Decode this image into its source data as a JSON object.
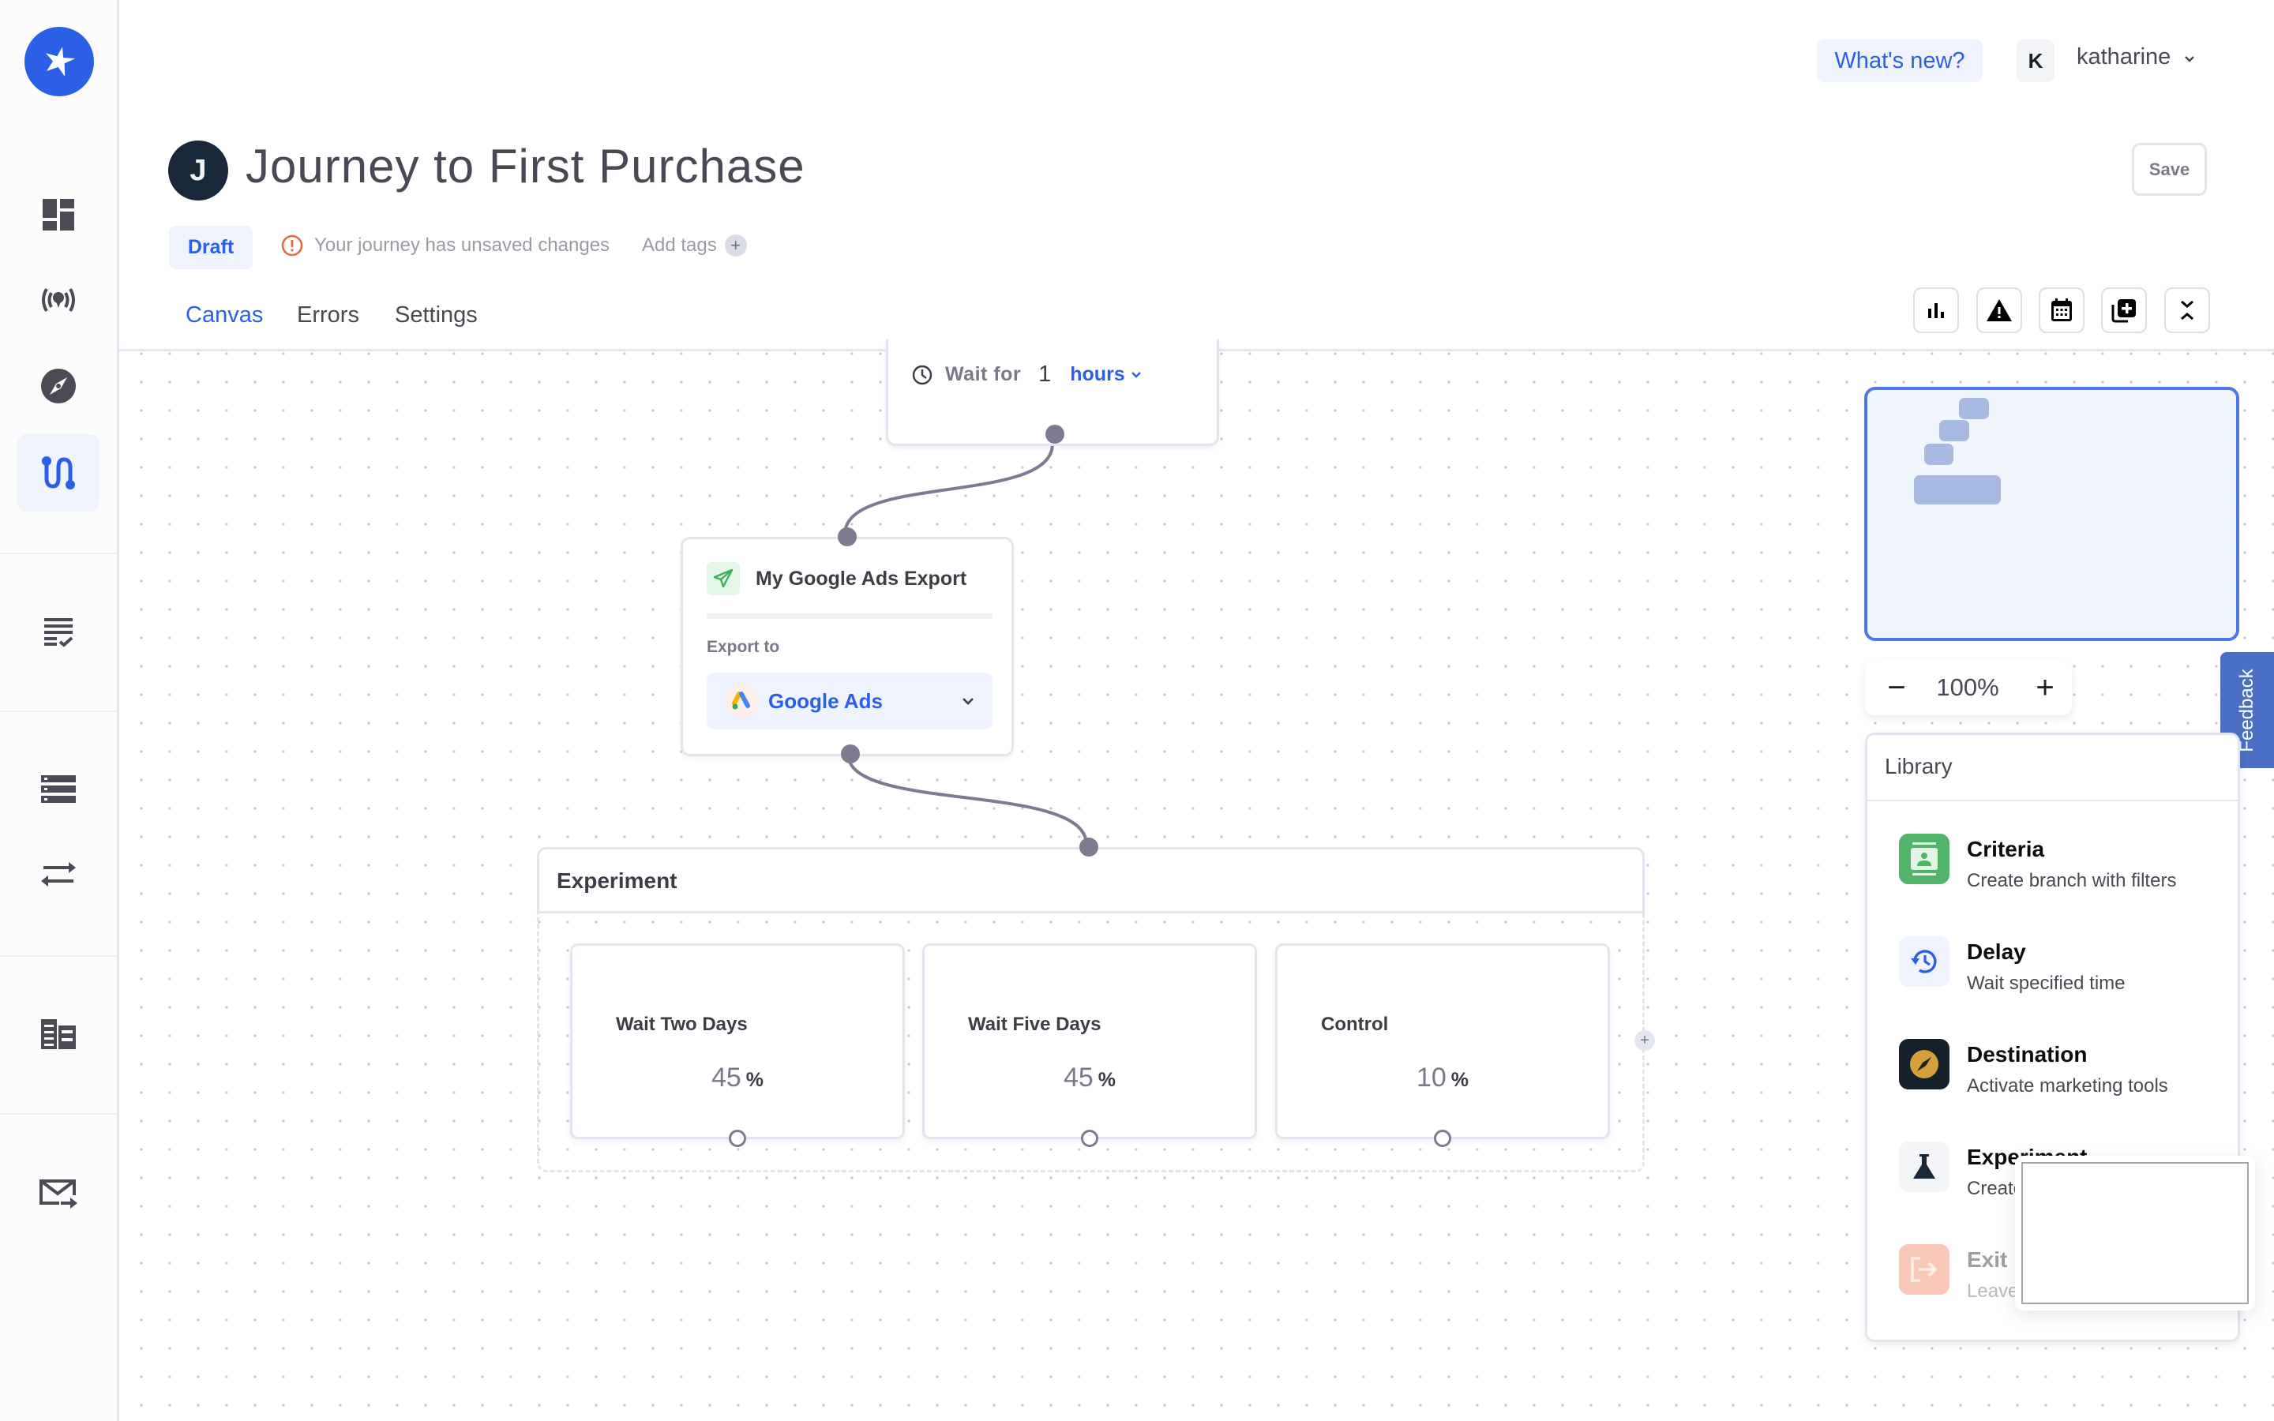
{
  "app": {
    "sidebar": {
      "logo": "brand-star-logo",
      "items": [
        {
          "name": "dashboard",
          "icon": "dashboard-icon",
          "active": false
        },
        {
          "name": "sources",
          "icon": "broadcast-icon",
          "active": false
        },
        {
          "name": "explore",
          "icon": "compass-icon",
          "active": false
        },
        {
          "name": "journeys",
          "icon": "journey-path-icon",
          "active": true
        },
        {
          "name": "audiences",
          "icon": "checklist-icon",
          "active": false
        },
        {
          "name": "data-models",
          "icon": "database-icon",
          "active": false
        },
        {
          "name": "syncs",
          "icon": "swap-arrows-icon",
          "active": false
        },
        {
          "name": "catalog",
          "icon": "catalog-icon",
          "active": false
        },
        {
          "name": "messages",
          "icon": "mail-send-icon",
          "active": false
        }
      ]
    }
  },
  "header": {
    "whats_new": "What's new?",
    "user": {
      "initial": "K",
      "name": "katharine"
    },
    "title_initial": "J",
    "title": "Journey to First Purchase",
    "save_label": "Save",
    "status_badge": "Draft",
    "unsaved_message": "Your journey has unsaved changes",
    "add_tags_label": "Add tags",
    "add_tags_plus": "+",
    "tabs": [
      {
        "label": "Canvas",
        "active": true
      },
      {
        "label": "Errors",
        "active": false
      },
      {
        "label": "Settings",
        "active": false
      }
    ],
    "toolbar": [
      {
        "name": "stats",
        "icon": "bar-chart-icon"
      },
      {
        "name": "warnings",
        "icon": "warning-icon"
      },
      {
        "name": "schedule",
        "icon": "calendar-icon"
      },
      {
        "name": "duplicate",
        "icon": "add-copy-icon"
      },
      {
        "name": "collapse",
        "icon": "collapse-icon"
      }
    ]
  },
  "canvas": {
    "wait_node": {
      "label": "Wait for",
      "value": "1",
      "unit": "hours"
    },
    "export_node": {
      "title": "My Google Ads Export",
      "export_to_label": "Export to",
      "destination": "Google Ads"
    },
    "experiment_node": {
      "title": "Experiment",
      "add_branch": "+",
      "branches": [
        {
          "name": "Wait Two Days",
          "percent": "45",
          "percent_symbol": "%"
        },
        {
          "name": "Wait Five Days",
          "percent": "45",
          "percent_symbol": "%"
        },
        {
          "name": "Control",
          "percent": "10",
          "percent_symbol": "%"
        }
      ]
    }
  },
  "zoom": {
    "minus": "−",
    "value": "100%",
    "plus": "+"
  },
  "feedback_label": "Feedback",
  "library": {
    "title": "Library",
    "items": [
      {
        "name": "Criteria",
        "description": "Create branch with filters",
        "icon": "contact-card-icon"
      },
      {
        "name": "Delay",
        "description": "Wait specified time",
        "icon": "history-clock-icon"
      },
      {
        "name": "Destination",
        "description": "Activate marketing tools",
        "icon": "compass-icon"
      },
      {
        "name": "Experiment",
        "description": "Create",
        "icon": "flask-icon"
      },
      {
        "name": "Exit",
        "description": "Leave",
        "icon": "exit-icon"
      }
    ]
  },
  "colors": {
    "accent": "#2a5fe6",
    "sidebar_active_bg": "#eef3fd",
    "connector": "#7e7a92",
    "feedback": "#4a6fc4",
    "criteria_green": "#52b36b",
    "exit_salmon": "#f8c8b9",
    "destination_dark": "#15202b"
  }
}
